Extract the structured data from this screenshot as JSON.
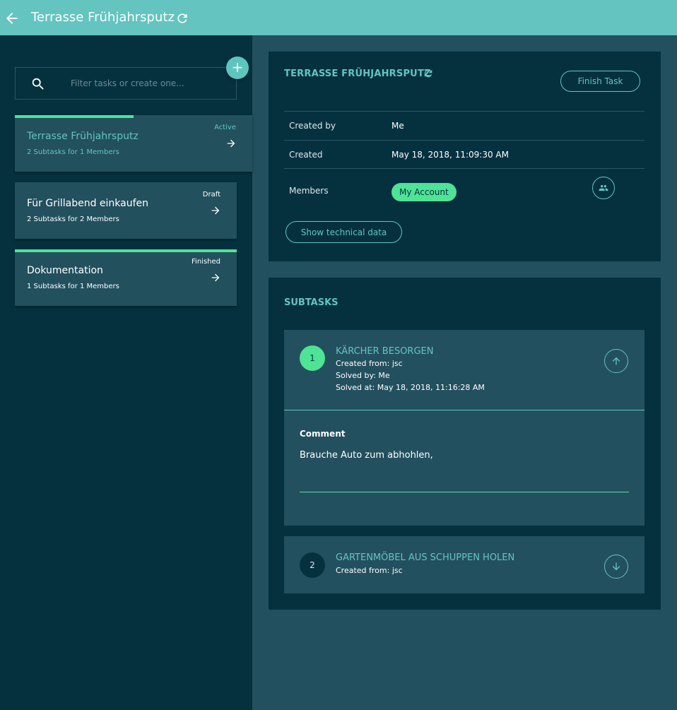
{
  "header": {
    "title": "Terrasse Frühjahrsputz",
    "back_icon": "arrow-left-icon",
    "refresh_icon": "refresh-icon"
  },
  "sidebar": {
    "search_placeholder": "Filter tasks or create one...",
    "add_label": "+",
    "tasks": [
      {
        "name": "Terrasse Frühjahrsputz",
        "subtitle": "2 Subtasks for 1 Members",
        "status": "Active",
        "progress": 0.5
      },
      {
        "name": "Für Grillabend einkaufen",
        "subtitle": "2 Subtasks for 2 Members",
        "status": "Draft",
        "progress": 0
      },
      {
        "name": "Dokumentation",
        "subtitle": "1 Subtasks for 1 Members",
        "status": "Finished",
        "progress": 1
      }
    ]
  },
  "detail": {
    "heading": "TERRASSE FRÜHJAHRSPUTZ",
    "finish_label": "Finish Task",
    "created_by_label": "Created by",
    "created_by_value": "Me",
    "created_label": "Created",
    "created_value": "May 18, 2018, 11:09:30 AM",
    "members_label": "Members",
    "member_chip": "My Account",
    "tech_label": "Show technical data"
  },
  "subtasks": {
    "heading": "SUBTASKS",
    "items": [
      {
        "number": "1",
        "title": "KÄRCHER BESORGEN",
        "created_from": "Created from: jsc",
        "solved_by": "Solved by: Me",
        "solved_at": "Solved at: May 18, 2018, 11:16:28 AM",
        "comment_label": "Comment",
        "comment_value": "Brauche Auto zum abhohlen,",
        "expanded": true
      },
      {
        "number": "2",
        "title": "GARTENMÖBEL AUS SCHUPPEN HOLEN",
        "created_from": "Created from: jsc",
        "expanded": false
      }
    ]
  },
  "colors": {
    "accent": "#63c4c0",
    "green": "#4fe395",
    "dark": "#05313f",
    "mid": "#23505e"
  }
}
